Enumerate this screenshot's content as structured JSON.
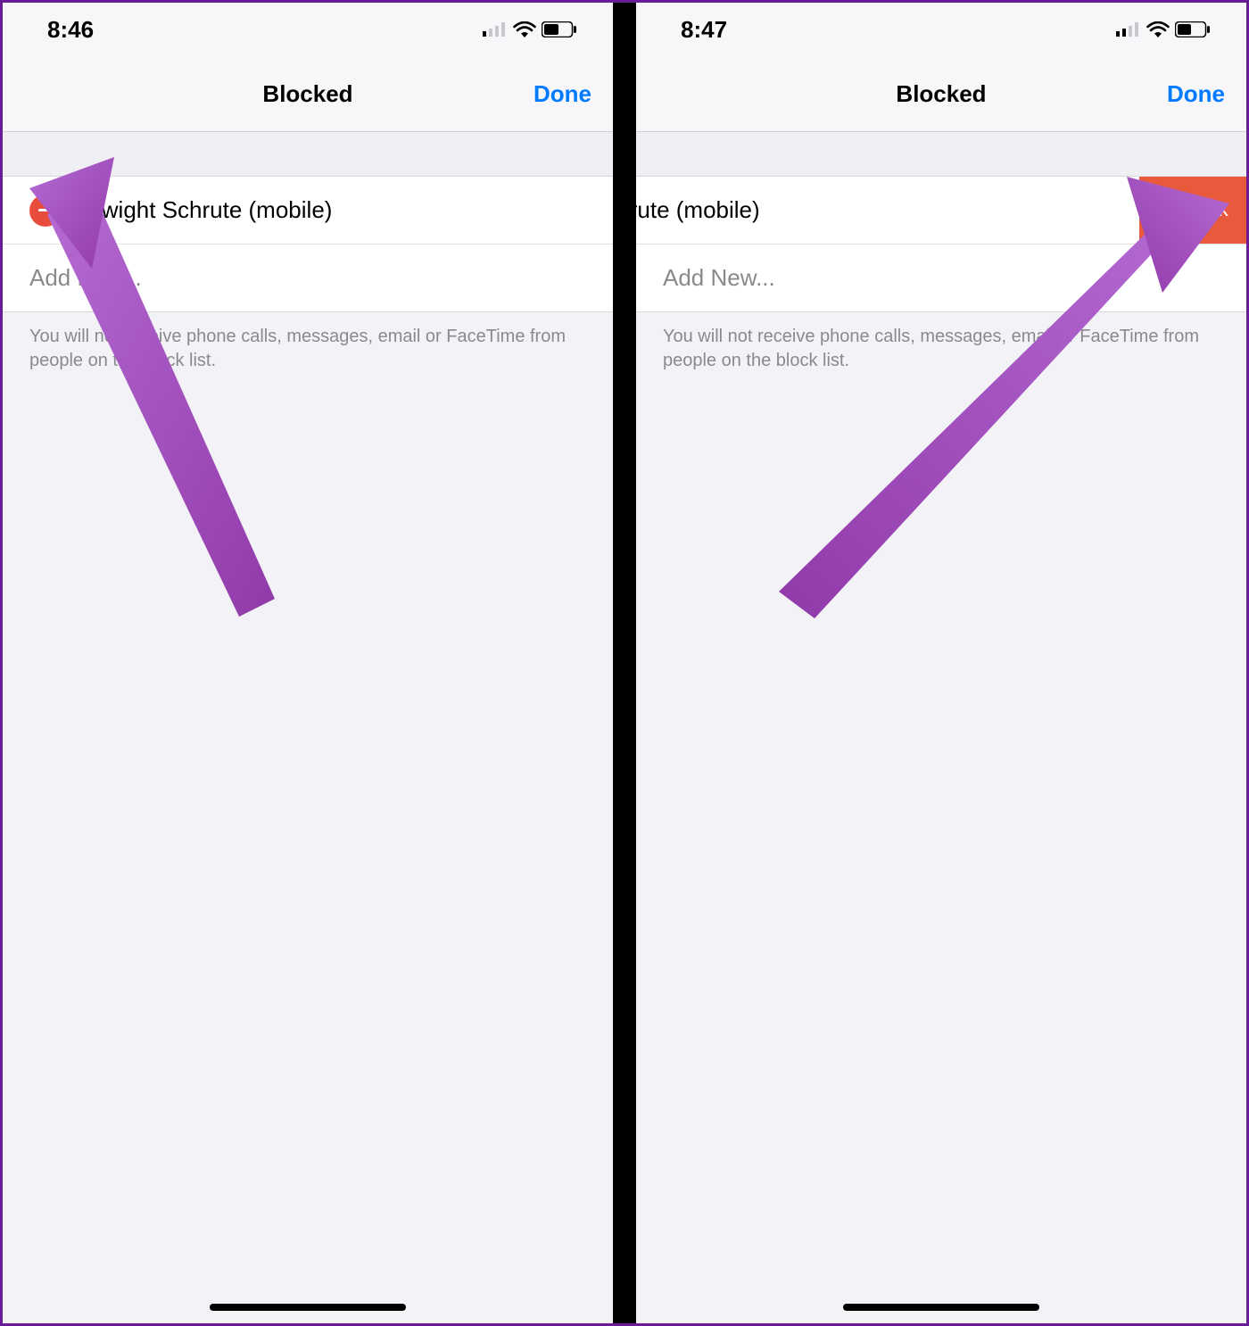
{
  "left": {
    "status_time": "8:46",
    "cell_bars_active": 1,
    "nav_title": "Blocked",
    "nav_done": "Done",
    "contact_name": "Dwight Schrute (mobile)",
    "add_new_label": "Add New...",
    "footnote": "You will not receive phone calls, messages, email or FaceTime from people on the block list."
  },
  "right": {
    "status_time": "8:47",
    "cell_bars_active": 2,
    "nav_title": "Blocked",
    "nav_done": "Done",
    "contact_name_partial": "wight Schrute (mobile)",
    "unblock_label": "Unblock",
    "add_new_label": "Add New...",
    "footnote": "You will not receive phone calls, messages, email or FaceTime from people on the block list."
  },
  "colors": {
    "accent_blue": "#007aff",
    "delete_red": "#e74c3c",
    "unblock_orange": "#e85a3b",
    "annotation_purple": "#a24bc2"
  }
}
